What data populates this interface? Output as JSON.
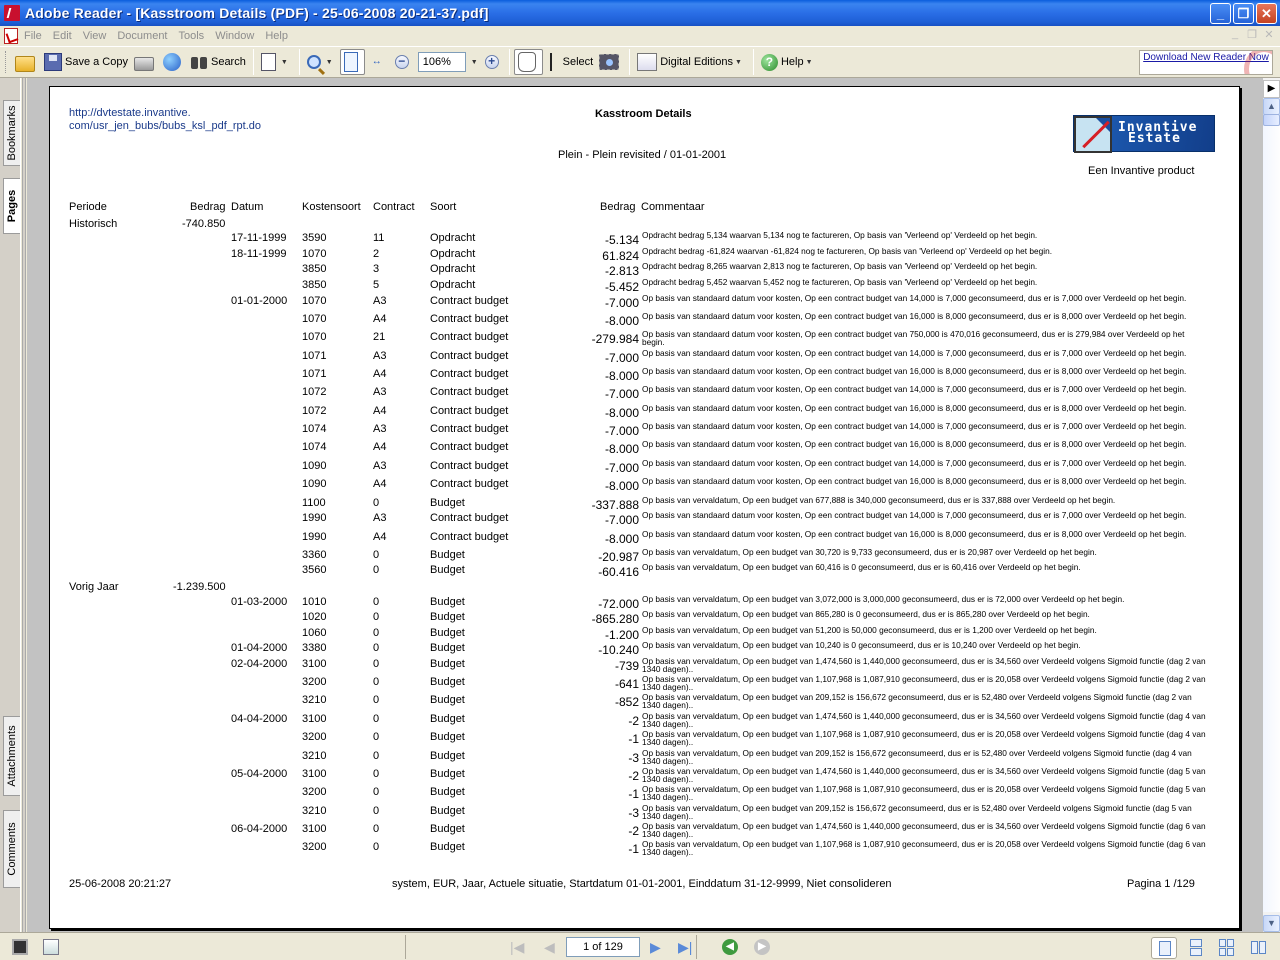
{
  "window": {
    "title": "Adobe Reader - [Kasstroom Details (PDF) - 25-06-2008 20-21-37.pdf]"
  },
  "menu": [
    "File",
    "Edit",
    "View",
    "Document",
    "Tools",
    "Window",
    "Help"
  ],
  "toolbar": {
    "save_copy": "Save a Copy",
    "search": "Search",
    "zoom": "106%",
    "select": "Select",
    "digital_editions": "Digital Editions",
    "help": "Help",
    "download": "Download New Reader Now"
  },
  "navpane": {
    "tabs": [
      "Bookmarks",
      "Pages",
      "Attachments",
      "Comments"
    ]
  },
  "document": {
    "url": [
      "http://dvtestate.invantive.",
      "com/usr_jen_bubs/bubs_ksl_pdf_rpt.do"
    ],
    "title": "Kasstroom Details",
    "subtitle": "Plein - Plein revisited / 01-01-2001",
    "logo_text": [
      "Invantive",
      "Estate"
    ],
    "product": "Een Invantive product",
    "columns": {
      "periode": "Periode",
      "bedrag": "Bedrag",
      "datum": "Datum",
      "kostensoort": "Kostensoort",
      "contract": "Contract",
      "soort": "Soort",
      "bedrag2": "Bedrag",
      "commentaar": "Commentaar"
    },
    "groups": [
      {
        "periode": "Historisch",
        "bedrag": "-740.850"
      },
      {
        "periode": "Vorig Jaar",
        "bedrag": "-1.239.500"
      }
    ],
    "rows": [
      {
        "datum": "17-11-1999",
        "ks": "3590",
        "contract": "11",
        "soort": "Opdracht",
        "bedrag": "-5.134",
        "comment": "Opdracht bedrag 5,134 waarvan 5,134 nog te factureren, Op basis van 'Verleend op' Verdeeld op het begin."
      },
      {
        "datum": "18-11-1999",
        "ks": "1070",
        "contract": "2",
        "soort": "Opdracht",
        "bedrag": "61.824",
        "comment": "Opdracht bedrag -61,824 waarvan -61,824 nog te factureren, Op basis van 'Verleend op' Verdeeld op het begin."
      },
      {
        "datum": "",
        "ks": "3850",
        "contract": "3",
        "soort": "Opdracht",
        "bedrag": "-2.813",
        "comment": "Opdracht bedrag 8,265 waarvan 2,813 nog te factureren, Op basis van 'Verleend op' Verdeeld op het begin."
      },
      {
        "datum": "",
        "ks": "3850",
        "contract": "5",
        "soort": "Opdracht",
        "bedrag": "-5.452",
        "comment": "Opdracht bedrag 5,452 waarvan 5,452 nog te factureren, Op basis van 'Verleend op' Verdeeld op het begin."
      },
      {
        "datum": "01-01-2000",
        "ks": "1070",
        "contract": "A3",
        "soort": "Contract budget",
        "bedrag": "-7.000",
        "comment": "Op basis van standaard datum voor kosten, Op een contract budget van 14,000 is 7,000 geconsumeerd, dus er is 7,000 over Verdeeld op het begin."
      },
      {
        "datum": "",
        "ks": "1070",
        "contract": "A4",
        "soort": "Contract budget",
        "bedrag": "-8.000",
        "comment": "Op basis van standaard datum voor kosten, Op een contract budget van 16,000 is 8,000 geconsumeerd, dus er is 8,000 over Verdeeld op het begin."
      },
      {
        "datum": "",
        "ks": "1070",
        "contract": "21",
        "soort": "Contract budget",
        "bedrag": "-279.984",
        "comment": "Op basis van standaard datum voor kosten, Op een contract budget van 750,000 is 470,016 geconsumeerd, dus er is 279,984 over Verdeeld op het begin."
      },
      {
        "datum": "",
        "ks": "1071",
        "contract": "A3",
        "soort": "Contract budget",
        "bedrag": "-7.000",
        "comment": "Op basis van standaard datum voor kosten, Op een contract budget van 14,000 is 7,000 geconsumeerd, dus er is 7,000 over Verdeeld op het begin."
      },
      {
        "datum": "",
        "ks": "1071",
        "contract": "A4",
        "soort": "Contract budget",
        "bedrag": "-8.000",
        "comment": "Op basis van standaard datum voor kosten, Op een contract budget van 16,000 is 8,000 geconsumeerd, dus er is 8,000 over Verdeeld op het begin."
      },
      {
        "datum": "",
        "ks": "1072",
        "contract": "A3",
        "soort": "Contract budget",
        "bedrag": "-7.000",
        "comment": "Op basis van standaard datum voor kosten, Op een contract budget van 14,000 is 7,000 geconsumeerd, dus er is 7,000 over Verdeeld op het begin."
      },
      {
        "datum": "",
        "ks": "1072",
        "contract": "A4",
        "soort": "Contract budget",
        "bedrag": "-8.000",
        "comment": "Op basis van standaard datum voor kosten, Op een contract budget van 16,000 is 8,000 geconsumeerd, dus er is 8,000 over Verdeeld op het begin."
      },
      {
        "datum": "",
        "ks": "1074",
        "contract": "A3",
        "soort": "Contract budget",
        "bedrag": "-7.000",
        "comment": "Op basis van standaard datum voor kosten, Op een contract budget van 14,000 is 7,000 geconsumeerd, dus er is 7,000 over Verdeeld op het begin."
      },
      {
        "datum": "",
        "ks": "1074",
        "contract": "A4",
        "soort": "Contract budget",
        "bedrag": "-8.000",
        "comment": "Op basis van standaard datum voor kosten, Op een contract budget van 16,000 is 8,000 geconsumeerd, dus er is 8,000 over Verdeeld op het begin."
      },
      {
        "datum": "",
        "ks": "1090",
        "contract": "A3",
        "soort": "Contract budget",
        "bedrag": "-7.000",
        "comment": "Op basis van standaard datum voor kosten, Op een contract budget van 14,000 is 7,000 geconsumeerd, dus er is 7,000 over Verdeeld op het begin."
      },
      {
        "datum": "",
        "ks": "1090",
        "contract": "A4",
        "soort": "Contract budget",
        "bedrag": "-8.000",
        "comment": "Op basis van standaard datum voor kosten, Op een contract budget van 16,000 is 8,000 geconsumeerd, dus er is 8,000 over Verdeeld op het begin."
      },
      {
        "datum": "",
        "ks": "1100",
        "contract": "0",
        "soort": "Budget",
        "bedrag": "-337.888",
        "comment": "Op basis van vervaldatum, Op een budget van 677,888 is 340,000 geconsumeerd, dus er is 337,888 over Verdeeld op het begin."
      },
      {
        "datum": "",
        "ks": "1990",
        "contract": "A3",
        "soort": "Contract budget",
        "bedrag": "-7.000",
        "comment": "Op basis van standaard datum voor kosten, Op een contract budget van 14,000 is 7,000 geconsumeerd, dus er is 7,000 over Verdeeld op het begin."
      },
      {
        "datum": "",
        "ks": "1990",
        "contract": "A4",
        "soort": "Contract budget",
        "bedrag": "-8.000",
        "comment": "Op basis van standaard datum voor kosten, Op een contract budget van 16,000 is 8,000 geconsumeerd, dus er is 8,000 over Verdeeld op het begin."
      },
      {
        "datum": "",
        "ks": "3360",
        "contract": "0",
        "soort": "Budget",
        "bedrag": "-20.987",
        "comment": "Op basis van vervaldatum, Op een budget van 30,720 is 9,733 geconsumeerd, dus er is 20,987 over Verdeeld op het begin."
      },
      {
        "datum": "",
        "ks": "3560",
        "contract": "0",
        "soort": "Budget",
        "bedrag": "-60.416",
        "comment": "Op basis van vervaldatum, Op een budget van 60,416 is 0 geconsumeerd, dus er is 60,416 over Verdeeld op het begin."
      },
      {
        "datum": "01-03-2000",
        "ks": "1010",
        "contract": "0",
        "soort": "Budget",
        "bedrag": "-72.000",
        "comment": "Op basis van vervaldatum, Op een budget van 3,072,000 is 3,000,000 geconsumeerd, dus er is 72,000 over Verdeeld op het begin."
      },
      {
        "datum": "",
        "ks": "1020",
        "contract": "0",
        "soort": "Budget",
        "bedrag": "-865.280",
        "comment": "Op basis van vervaldatum, Op een budget van 865,280 is 0 geconsumeerd, dus er is 865,280 over Verdeeld op het begin."
      },
      {
        "datum": "",
        "ks": "1060",
        "contract": "0",
        "soort": "Budget",
        "bedrag": "-1.200",
        "comment": "Op basis van vervaldatum, Op een budget van 51,200 is 50,000 geconsumeerd, dus er is 1,200 over Verdeeld op het begin."
      },
      {
        "datum": "01-04-2000",
        "ks": "3380",
        "contract": "0",
        "soort": "Budget",
        "bedrag": "-10.240",
        "comment": "Op basis van vervaldatum, Op een budget van 10,240 is 0 geconsumeerd, dus er is 10,240 over Verdeeld op het begin."
      },
      {
        "datum": "02-04-2000",
        "ks": "3100",
        "contract": "0",
        "soort": "Budget",
        "bedrag": "-739",
        "comment": "Op basis van vervaldatum, Op een budget van 1,474,560 is 1,440,000 geconsumeerd, dus er is 34,560 over Verdeeld volgens Sigmoid functie (dag 2 van 1340 dagen).."
      },
      {
        "datum": "",
        "ks": "3200",
        "contract": "0",
        "soort": "Budget",
        "bedrag": "-641",
        "comment": "Op basis van vervaldatum, Op een budget van 1,107,968 is 1,087,910 geconsumeerd, dus er is 20,058 over Verdeeld volgens Sigmoid functie (dag 2 van 1340 dagen).."
      },
      {
        "datum": "",
        "ks": "3210",
        "contract": "0",
        "soort": "Budget",
        "bedrag": "-852",
        "comment": "Op basis van vervaldatum, Op een budget van 209,152 is 156,672 geconsumeerd, dus er is 52,480 over Verdeeld volgens Sigmoid functie (dag 2 van 1340 dagen).."
      },
      {
        "datum": "04-04-2000",
        "ks": "3100",
        "contract": "0",
        "soort": "Budget",
        "bedrag": "-2",
        "comment": "Op basis van vervaldatum, Op een budget van 1,474,560 is 1,440,000 geconsumeerd, dus er is 34,560 over Verdeeld volgens Sigmoid functie (dag 4 van 1340 dagen).."
      },
      {
        "datum": "",
        "ks": "3200",
        "contract": "0",
        "soort": "Budget",
        "bedrag": "-1",
        "comment": "Op basis van vervaldatum, Op een budget van 1,107,968 is 1,087,910 geconsumeerd, dus er is 20,058 over Verdeeld volgens Sigmoid functie (dag 4 van 1340 dagen).."
      },
      {
        "datum": "",
        "ks": "3210",
        "contract": "0",
        "soort": "Budget",
        "bedrag": "-3",
        "comment": "Op basis van vervaldatum, Op een budget van 209,152 is 156,672 geconsumeerd, dus er is 52,480 over Verdeeld volgens Sigmoid functie (dag 4 van 1340 dagen).."
      },
      {
        "datum": "05-04-2000",
        "ks": "3100",
        "contract": "0",
        "soort": "Budget",
        "bedrag": "-2",
        "comment": "Op basis van vervaldatum, Op een budget van 1,474,560 is 1,440,000 geconsumeerd, dus er is 34,560 over Verdeeld volgens Sigmoid functie (dag 5 van 1340 dagen).."
      },
      {
        "datum": "",
        "ks": "3200",
        "contract": "0",
        "soort": "Budget",
        "bedrag": "-1",
        "comment": "Op basis van vervaldatum, Op een budget van 1,107,968 is 1,087,910 geconsumeerd, dus er is 20,058 over Verdeeld volgens Sigmoid functie (dag 5 van 1340 dagen).."
      },
      {
        "datum": "",
        "ks": "3210",
        "contract": "0",
        "soort": "Budget",
        "bedrag": "-3",
        "comment": "Op basis van vervaldatum, Op een budget van 209,152 is 156,672 geconsumeerd, dus er is 52,480 over Verdeeld volgens Sigmoid functie (dag 5 van 1340 dagen).."
      },
      {
        "datum": "06-04-2000",
        "ks": "3100",
        "contract": "0",
        "soort": "Budget",
        "bedrag": "-2",
        "comment": "Op basis van vervaldatum, Op een budget van 1,474,560 is 1,440,000 geconsumeerd, dus er is 34,560 over Verdeeld volgens Sigmoid functie (dag 6 van 1340 dagen).."
      },
      {
        "datum": "",
        "ks": "3200",
        "contract": "0",
        "soort": "Budget",
        "bedrag": "-1",
        "comment": "Op basis van vervaldatum, Op een budget van 1,107,968 is 1,087,910 geconsumeerd, dus er is 20,058 over Verdeeld volgens Sigmoid functie (dag 6 van 1340 dagen).."
      }
    ],
    "footer": {
      "timestamp": "25-06-2008 20:21:27",
      "params": "system, EUR, Jaar, Actuele situatie, Startdatum 01-01-2001, Einddatum 31-12-9999, Niet consolideren",
      "page": "Pagina 1 /129"
    }
  },
  "statusbar": {
    "page_indicator": "1 of 129"
  }
}
